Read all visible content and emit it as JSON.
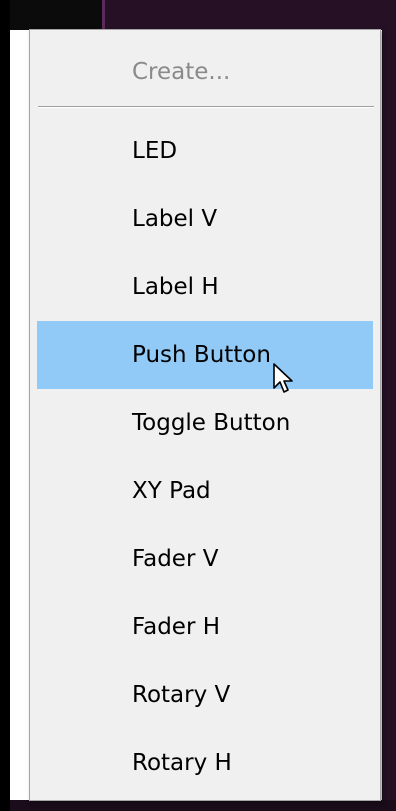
{
  "menu": {
    "header": "Create...",
    "items": [
      {
        "label": "LED"
      },
      {
        "label": "Label V"
      },
      {
        "label": "Label H"
      },
      {
        "label": "Push Button"
      },
      {
        "label": "Toggle Button"
      },
      {
        "label": "XY Pad"
      },
      {
        "label": "Fader V"
      },
      {
        "label": "Fader H"
      },
      {
        "label": "Rotary V"
      },
      {
        "label": "Rotary H"
      }
    ],
    "highlighted_item": "Push Button"
  },
  "colors": {
    "menu_background": "#f0f0f0",
    "highlight": "#91c9f7",
    "header_text": "#8a8a8a",
    "item_text": "#000000",
    "window_background": "#251025"
  },
  "icons": {
    "cursor": "mouse-pointer-icon"
  }
}
